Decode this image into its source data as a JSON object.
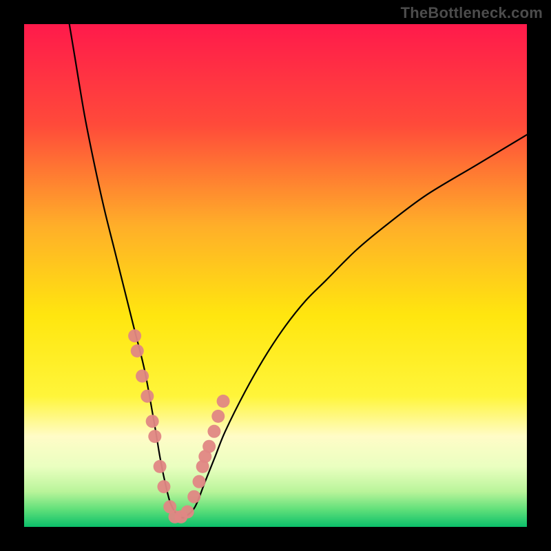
{
  "watermark": "TheBottleneck.com",
  "chart_data": {
    "type": "line",
    "title": "",
    "xlabel": "",
    "ylabel": "",
    "xlim": [
      0,
      100
    ],
    "ylim": [
      0,
      100
    ],
    "background_gradient": {
      "stops": [
        {
          "offset": 0.0,
          "color": "#ff1a4b"
        },
        {
          "offset": 0.2,
          "color": "#ff4a3a"
        },
        {
          "offset": 0.4,
          "color": "#ffae29"
        },
        {
          "offset": 0.58,
          "color": "#ffe60f"
        },
        {
          "offset": 0.74,
          "color": "#fff53a"
        },
        {
          "offset": 0.82,
          "color": "#fffcc7"
        },
        {
          "offset": 0.88,
          "color": "#eaffc0"
        },
        {
          "offset": 0.93,
          "color": "#b9f49a"
        },
        {
          "offset": 0.965,
          "color": "#61e07a"
        },
        {
          "offset": 1.0,
          "color": "#0bbf6a"
        }
      ]
    },
    "series": [
      {
        "name": "bottleneck-curve",
        "type": "line",
        "x": [
          9,
          10,
          12,
          14,
          16,
          18,
          20,
          22,
          24,
          26,
          27,
          28,
          29,
          30,
          31,
          32,
          34,
          36,
          38,
          40,
          44,
          48,
          52,
          56,
          60,
          66,
          72,
          80,
          90,
          100
        ],
        "y": [
          100,
          94,
          82,
          72,
          63,
          55,
          47,
          39,
          31,
          20,
          14,
          9,
          5,
          3,
          2,
          2,
          4,
          9,
          14,
          19,
          27,
          34,
          40,
          45,
          49,
          55,
          60,
          66,
          72,
          78
        ]
      },
      {
        "name": "marker-cluster",
        "type": "scatter",
        "x": [
          22.0,
          22.5,
          23.5,
          24.5,
          25.5,
          26.0,
          27.0,
          27.8,
          29.0,
          30.0,
          31.2,
          32.5,
          33.8,
          34.8,
          35.5,
          36.0,
          36.8,
          37.8,
          38.6,
          39.6
        ],
        "y": [
          38,
          35,
          30,
          26,
          21,
          18,
          12,
          8,
          4,
          2,
          2,
          3,
          6,
          9,
          12,
          14,
          16,
          19,
          22,
          25
        ],
        "color": "#e08784"
      }
    ]
  }
}
